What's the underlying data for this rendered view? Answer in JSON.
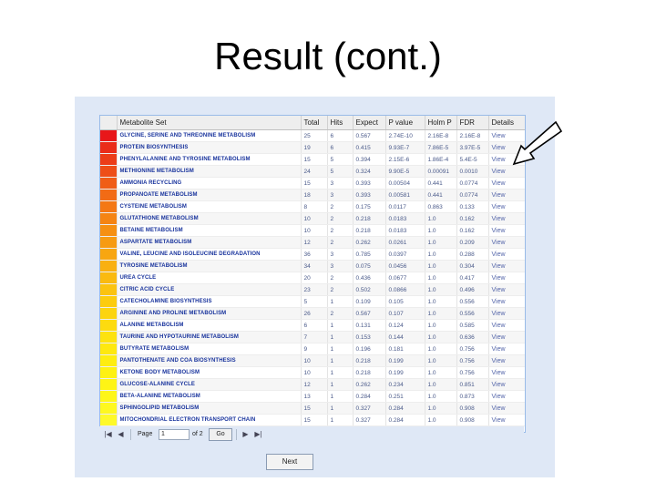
{
  "slide": {
    "title": "Result (cont.)"
  },
  "table": {
    "columns": [
      "Metabolite Set",
      "Total",
      "Hits",
      "Expect",
      "P value",
      "Holm P",
      "FDR",
      "Details"
    ],
    "rows": [
      {
        "name": "GLYCINE, SERINE AND THREONINE METABOLISM",
        "total": "25",
        "hits": "6",
        "expect": "0.567",
        "p": "2.74E-10",
        "holm": "2.16E-8",
        "fdr": "2.16E-8",
        "details": "View",
        "color": "#e8171a"
      },
      {
        "name": "PROTEIN BIOSYNTHESIS",
        "total": "19",
        "hits": "6",
        "expect": "0.415",
        "p": "9.93E-7",
        "holm": "7.86E-5",
        "fdr": "3.97E-5",
        "details": "View",
        "color": "#ea2c19"
      },
      {
        "name": "PHENYLALANINE AND TYROSINE METABOLISM",
        "total": "15",
        "hits": "5",
        "expect": "0.394",
        "p": "2.15E-6",
        "holm": "1.86E-4",
        "fdr": "5.4E-5",
        "details": "View",
        "color": "#ec3d18"
      },
      {
        "name": "METHIONINE METABOLISM",
        "total": "24",
        "hits": "5",
        "expect": "0.324",
        "p": "9.90E-5",
        "holm": "0.00091",
        "fdr": "0.0010",
        "details": "View",
        "color": "#ee4e17"
      },
      {
        "name": "AMMONIA RECYCLING",
        "total": "15",
        "hits": "3",
        "expect": "0.393",
        "p": "0.00504",
        "holm": "0.441",
        "fdr": "0.0774",
        "details": "View",
        "color": "#f05d16"
      },
      {
        "name": "PROPANOATE METABOLISM",
        "total": "18",
        "hits": "3",
        "expect": "0.393",
        "p": "0.00581",
        "holm": "0.441",
        "fdr": "0.0774",
        "details": "View",
        "color": "#f26b15"
      },
      {
        "name": "CYSTEINE METABOLISM",
        "total": "8",
        "hits": "2",
        "expect": "0.175",
        "p": "0.0117",
        "holm": "0.863",
        "fdr": "0.133",
        "details": "View",
        "color": "#f47814"
      },
      {
        "name": "GLUTATHIONE METABOLISM",
        "total": "10",
        "hits": "2",
        "expect": "0.218",
        "p": "0.0183",
        "holm": "1.0",
        "fdr": "0.162",
        "details": "View",
        "color": "#f58413"
      },
      {
        "name": "BETAINE METABOLISM",
        "total": "10",
        "hits": "2",
        "expect": "0.218",
        "p": "0.0183",
        "holm": "1.0",
        "fdr": "0.162",
        "details": "View",
        "color": "#f69012"
      },
      {
        "name": "ASPARTATE METABOLISM",
        "total": "12",
        "hits": "2",
        "expect": "0.262",
        "p": "0.0261",
        "holm": "1.0",
        "fdr": "0.209",
        "details": "View",
        "color": "#f79b12"
      },
      {
        "name": "VALINE, LEUCINE AND ISOLEUCINE DEGRADATION",
        "total": "36",
        "hits": "3",
        "expect": "0.785",
        "p": "0.0397",
        "holm": "1.0",
        "fdr": "0.288",
        "details": "View",
        "color": "#f8a611"
      },
      {
        "name": "TYROSINE METABOLISM",
        "total": "34",
        "hits": "3",
        "expect": "0.075",
        "p": "0.0456",
        "holm": "1.0",
        "fdr": "0.304",
        "details": "View",
        "color": "#f9b011"
      },
      {
        "name": "UREA CYCLE",
        "total": "20",
        "hits": "2",
        "expect": "0.436",
        "p": "0.0677",
        "holm": "1.0",
        "fdr": "0.417",
        "details": "View",
        "color": "#faba10"
      },
      {
        "name": "CITRIC ACID CYCLE",
        "total": "23",
        "hits": "2",
        "expect": "0.502",
        "p": "0.0866",
        "holm": "1.0",
        "fdr": "0.496",
        "details": "View",
        "color": "#fbc310"
      },
      {
        "name": "CATECHOLAMINE BIOSYNTHESIS",
        "total": "5",
        "hits": "1",
        "expect": "0.109",
        "p": "0.105",
        "holm": "1.0",
        "fdr": "0.556",
        "details": "View",
        "color": "#fccc0f"
      },
      {
        "name": "ARGININE AND PROLINE METABOLISM",
        "total": "26",
        "hits": "2",
        "expect": "0.567",
        "p": "0.107",
        "holm": "1.0",
        "fdr": "0.556",
        "details": "View",
        "color": "#fcd40f"
      },
      {
        "name": "ALANINE METABOLISM",
        "total": "6",
        "hits": "1",
        "expect": "0.131",
        "p": "0.124",
        "holm": "1.0",
        "fdr": "0.585",
        "details": "View",
        "color": "#fddb0f"
      },
      {
        "name": "TAURINE AND HYPOTAURINE METABOLISM",
        "total": "7",
        "hits": "1",
        "expect": "0.153",
        "p": "0.144",
        "holm": "1.0",
        "fdr": "0.636",
        "details": "View",
        "color": "#fde20f"
      },
      {
        "name": "BUTYRATE METABOLISM",
        "total": "9",
        "hits": "1",
        "expect": "0.196",
        "p": "0.181",
        "holm": "1.0",
        "fdr": "0.756",
        "details": "View",
        "color": "#fee80f"
      },
      {
        "name": "PANTOTHENATE AND COA BIOSYNTHESIS",
        "total": "10",
        "hits": "1",
        "expect": "0.218",
        "p": "0.199",
        "holm": "1.0",
        "fdr": "0.756",
        "details": "View",
        "color": "#feed10"
      },
      {
        "name": "KETONE BODY METABOLISM",
        "total": "10",
        "hits": "1",
        "expect": "0.218",
        "p": "0.199",
        "holm": "1.0",
        "fdr": "0.756",
        "details": "View",
        "color": "#fef112"
      },
      {
        "name": "GLUCOSE-ALANINE CYCLE",
        "total": "12",
        "hits": "1",
        "expect": "0.262",
        "p": "0.234",
        "holm": "1.0",
        "fdr": "0.851",
        "details": "View",
        "color": "#fef415"
      },
      {
        "name": "BETA-ALANINE METABOLISM",
        "total": "13",
        "hits": "1",
        "expect": "0.284",
        "p": "0.251",
        "holm": "1.0",
        "fdr": "0.873",
        "details": "View",
        "color": "#fef619"
      },
      {
        "name": "SPHINGOLIPID METABOLISM",
        "total": "15",
        "hits": "1",
        "expect": "0.327",
        "p": "0.284",
        "holm": "1.0",
        "fdr": "0.908",
        "details": "View",
        "color": "#fef820"
      },
      {
        "name": "MITOCHONDRIAL ELECTRON TRANSPORT CHAIN",
        "total": "15",
        "hits": "1",
        "expect": "0.327",
        "p": "0.284",
        "holm": "1.0",
        "fdr": "0.908",
        "details": "View",
        "color": "#fef92a"
      }
    ]
  },
  "pager": {
    "first_icon": "first-page-icon",
    "prev_icon": "prev-page-icon",
    "page_label": "Page",
    "page_value": "1",
    "of_label": "of 2",
    "go_label": "Go",
    "next_icon": "next-page-icon",
    "last_icon": "last-page-icon"
  },
  "actions": {
    "next_label": "Next"
  },
  "annotation": {
    "arrow_icon": "arrow-pointer-icon"
  },
  "colors": {
    "panel_bg": "#dfe8f6",
    "grid_border": "#99bbe8",
    "link": "#17329c"
  }
}
